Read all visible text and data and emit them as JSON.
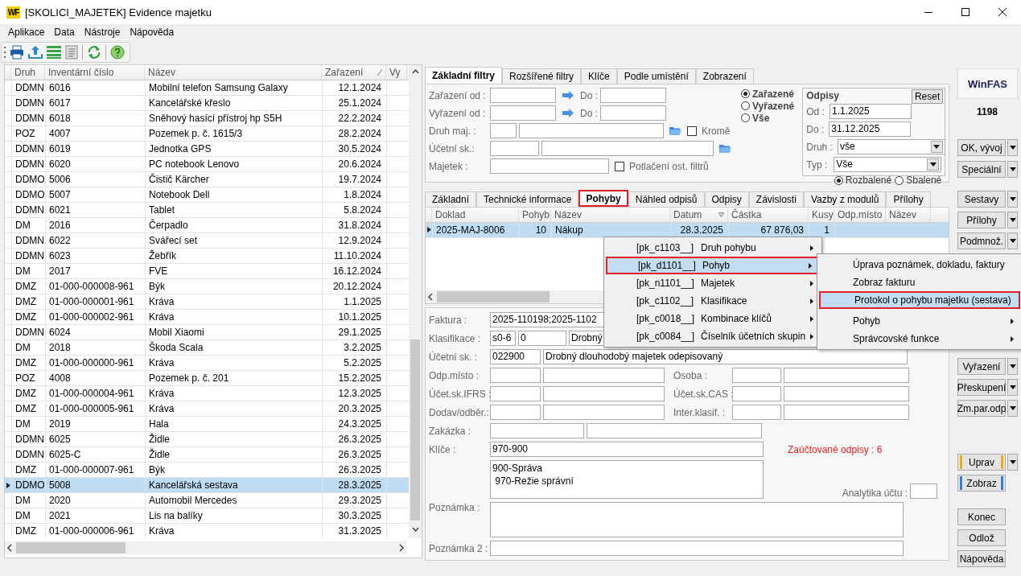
{
  "window": {
    "title": "[SKOLICI_MAJETEK] Evidence majetku",
    "app_badge": "WF"
  },
  "menu": [
    "Aplikace",
    "Data",
    "Nástroje",
    "Nápověda"
  ],
  "asset_table": {
    "columns": [
      "Druh",
      "Inventární číslo",
      "Název",
      "Zařazení",
      "Vy"
    ],
    "rows": [
      {
        "cells": [
          "DDMN",
          "6016",
          "Mobilní telefon Samsung Galaxy",
          "12.1.2024"
        ],
        "selected": false
      },
      {
        "cells": [
          "DDMN",
          "6017",
          "Kancelářské křeslo",
          "25.1.2024"
        ],
        "selected": false
      },
      {
        "cells": [
          "DDMN",
          "6018",
          "Sněhový hasící přístroj hp S5H",
          "22.2.2024"
        ],
        "selected": false
      },
      {
        "cells": [
          "POZ",
          "4007",
          "Pozemek p. č. 1615/3",
          "28.2.2024"
        ],
        "selected": false
      },
      {
        "cells": [
          "DDMN",
          "6019",
          "Jednotka GPS",
          "30.5.2024"
        ],
        "selected": false
      },
      {
        "cells": [
          "DDMN",
          "6020",
          "PC notebook Lenovo",
          "20.6.2024"
        ],
        "selected": false
      },
      {
        "cells": [
          "DDMO",
          "5006",
          "Čistič Kärcher",
          "19.7.2024"
        ],
        "selected": false
      },
      {
        "cells": [
          "DDMO",
          "5007",
          "Notebook Dell",
          "1.8.2024"
        ],
        "selected": false
      },
      {
        "cells": [
          "DDMN",
          "6021",
          "Tablet",
          "5.8.2024"
        ],
        "selected": false
      },
      {
        "cells": [
          "DM",
          "2016",
          "Čerpadlo",
          "31.8.2024"
        ],
        "selected": false
      },
      {
        "cells": [
          "DDMN",
          "6022",
          "Svářecí set",
          "12.9.2024"
        ],
        "selected": false
      },
      {
        "cells": [
          "DDMN",
          "6023",
          "Žebřík",
          "11.10.2024"
        ],
        "selected": false
      },
      {
        "cells": [
          "DM",
          "2017",
          "FVE",
          "16.12.2024"
        ],
        "selected": false
      },
      {
        "cells": [
          "DMZ",
          "01-000-000008-961",
          "Býk",
          "20.12.2024"
        ],
        "selected": false
      },
      {
        "cells": [
          "DMZ",
          "01-000-000001-961",
          "Kráva",
          "1.1.2025"
        ],
        "selected": false
      },
      {
        "cells": [
          "DMZ",
          "01-000-000002-961",
          "Kráva",
          "10.1.2025"
        ],
        "selected": false
      },
      {
        "cells": [
          "DDMN",
          "6024",
          "Mobil Xiaomi",
          "29.1.2025"
        ],
        "selected": false
      },
      {
        "cells": [
          "DM",
          "2018",
          "Škoda Scala",
          "3.2.2025"
        ],
        "selected": false
      },
      {
        "cells": [
          "DMZ",
          "01-000-000000-961",
          "Kráva",
          "5.2.2025"
        ],
        "selected": false
      },
      {
        "cells": [
          "POZ",
          "4008",
          "Pozemek p. č. 201",
          "15.2.2025"
        ],
        "selected": false
      },
      {
        "cells": [
          "DMZ",
          "01-000-000004-961",
          "Kráva",
          "12.3.2025"
        ],
        "selected": false
      },
      {
        "cells": [
          "DMZ",
          "01-000-000005-961",
          "Kráva",
          "20.3.2025"
        ],
        "selected": false
      },
      {
        "cells": [
          "DM",
          "2019",
          "Hala",
          "24.3.2025"
        ],
        "selected": false
      },
      {
        "cells": [
          "DDMN",
          "6025",
          "Židle",
          "26.3.2025"
        ],
        "selected": false
      },
      {
        "cells": [
          "DDMN",
          "6025-C",
          "Židle",
          "26.3.2025"
        ],
        "selected": false
      },
      {
        "cells": [
          "DMZ",
          "01-000-000007-961",
          "Býk",
          "26.3.2025"
        ],
        "selected": false
      },
      {
        "cells": [
          "DDMO",
          "5008",
          "Kancelářská sestava",
          "28.3.2025"
        ],
        "selected": true
      },
      {
        "cells": [
          "DM",
          "2020",
          "Automobil Mercedes",
          "29.3.2025"
        ],
        "selected": false
      },
      {
        "cells": [
          "DM",
          "2021",
          "Lis na balíky",
          "30.3.2025"
        ],
        "selected": false
      },
      {
        "cells": [
          "DMZ",
          "01-000-000006-961",
          "Kráva",
          "31.3.2025"
        ],
        "selected": false
      }
    ]
  },
  "filter_tabs": [
    {
      "label": "Základní filtry",
      "selected": true
    },
    {
      "label": "Rozšířené filtry",
      "selected": false
    },
    {
      "label": "Klíče",
      "selected": false
    },
    {
      "label": "Podle umístění",
      "selected": false
    },
    {
      "label": "Zobrazení",
      "selected": false
    }
  ],
  "filters": {
    "zarazeni": {
      "label": "Zařazení od :",
      "to_label": "Do :"
    },
    "vyrazeni": {
      "label": "Vyřazení od :",
      "to_label": "Do :"
    },
    "status_options": [
      {
        "label": "Zařazené",
        "selected": true
      },
      {
        "label": "Vyřazené",
        "selected": false
      },
      {
        "label": "Vše",
        "selected": false
      }
    ],
    "druh_maj": {
      "label": "Druh maj. :"
    },
    "krome": {
      "label": "Kromě",
      "checked": false
    },
    "ucetni_sk": {
      "label": "Účetní sk.:"
    },
    "majetek": {
      "label": "Majetek :"
    },
    "potlaceni": {
      "label": "Potlačení ost. filtrů",
      "checked": false
    }
  },
  "odpisy": {
    "title": "Odpisy",
    "reset": "Reset",
    "od_label": "Od :",
    "od": "1.1.2025",
    "do_label": "Do :",
    "do": "31.12.2025",
    "druh_label": "Druh :",
    "druh": "vše",
    "typ_label": "Typ :",
    "typ": "Vše",
    "view_options": [
      {
        "label": "Rozbalené",
        "selected": true
      },
      {
        "label": "Sbalené",
        "selected": false
      }
    ]
  },
  "detail_tabs": [
    {
      "label": "Základní",
      "selected": false,
      "highlighted": false
    },
    {
      "label": "Technické informace",
      "selected": false,
      "highlighted": false
    },
    {
      "label": "Pohyby",
      "selected": true,
      "highlighted": true
    },
    {
      "label": "Náhled odpisů",
      "selected": false,
      "highlighted": false
    },
    {
      "label": "Odpisy",
      "selected": false,
      "highlighted": false
    },
    {
      "label": "Závislosti",
      "selected": false,
      "highlighted": false
    },
    {
      "label": "Vazby z modulů",
      "selected": false,
      "highlighted": false
    },
    {
      "label": "Přílohy",
      "selected": false,
      "highlighted": false
    }
  ],
  "movements": {
    "columns": [
      "Doklad",
      "Pohyb",
      "Název",
      "Datum",
      "Částka",
      "Kusy",
      "Odp.místo",
      "Název"
    ],
    "rows": [
      {
        "cells": [
          "2025-MAJ-8006",
          "10",
          "Nákup",
          "28.3.2025",
          "67 876,03",
          "1"
        ],
        "selected": true
      }
    ]
  },
  "context_menu": {
    "items": [
      {
        "code": "[pk_c1103__]",
        "label": "Druh pohybu",
        "selected": false,
        "highlighted": false,
        "has_submenu": true
      },
      {
        "code": "[pk_d1101__]",
        "label": "Pohyb",
        "selected": true,
        "highlighted": true,
        "has_submenu": true
      },
      {
        "code": "[pk_n1101__]",
        "label": "Majetek",
        "selected": false,
        "highlighted": false,
        "has_submenu": true
      },
      {
        "code": "[pk_c1102__]",
        "label": "Klasifikace",
        "selected": false,
        "highlighted": false,
        "has_submenu": true
      },
      {
        "code": "[pk_c0018__]",
        "label": "Kombinace klíčů",
        "selected": false,
        "highlighted": false,
        "has_submenu": true
      },
      {
        "code": "[pk_c0084__]",
        "label": "Číselník účetních skupin",
        "selected": false,
        "highlighted": false,
        "has_submenu": true
      }
    ]
  },
  "submenu": {
    "items": [
      {
        "label": "Úprava poznámek, dokladu, faktury",
        "selected": false,
        "highlighted": false,
        "has_submenu": false
      },
      {
        "label": "Zobraz fakturu",
        "selected": false,
        "highlighted": false,
        "has_submenu": false
      },
      {
        "label": "Protokol o pohybu majetku (sestava)",
        "selected": true,
        "highlighted": true,
        "has_submenu": false
      },
      {
        "label": "Pohyb",
        "selected": false,
        "highlighted": false,
        "has_submenu": true
      },
      {
        "label": "Správcovské funkce",
        "selected": false,
        "highlighted": false,
        "has_submenu": true
      }
    ]
  },
  "form": {
    "faktura": {
      "label": "Faktura :",
      "value": "2025-110198;2025-1102"
    },
    "klasifikace": {
      "label": "Klasifikace :",
      "values": [
        "s0-6",
        "0",
        "Drobný"
      ]
    },
    "ucetni_sk": {
      "label": "Účetní sk. :",
      "values": [
        "022900",
        "Drobný dlouhodobý majetek odepisovaný"
      ]
    },
    "odp_misto": {
      "label": "Odp.místo :"
    },
    "osoba": {
      "label": "Osoba :"
    },
    "ucet_ifrs": {
      "label": "Účet.sk.IFRS :"
    },
    "ucet_cas": {
      "label": "Účet.sk.CAS :"
    },
    "dodav": {
      "label": "Dodav/odběr.:"
    },
    "inter": {
      "label": "Inter.klasif. :"
    },
    "zakazka": {
      "label": "Zakázka :"
    },
    "klice": {
      "label": "Klíče :",
      "value": "970-900",
      "lines": [
        "900-Správa",
        " 970-Režie správní"
      ]
    },
    "posted": "Zaúčtované odpisy : 6",
    "analytika": {
      "label": "Analytika účtu :"
    },
    "poznamka": {
      "label": "Poznámka :"
    },
    "poznamka2": {
      "label": "Poznámka 2 :"
    }
  },
  "side": {
    "logo": "WinFAS",
    "number": "1198",
    "button_groups": [
      [
        {
          "label": "OK, vývoj",
          "dropdown": true
        },
        {
          "label": "Speciální",
          "dropdown": true
        }
      ],
      [
        {
          "label": "Sestavy",
          "dropdown": true
        },
        {
          "label": "Přílohy",
          "dropdown": true
        },
        {
          "label": "Podmnož.",
          "dropdown": true
        }
      ],
      [
        {
          "label": "Vyřazení",
          "dropdown": true
        },
        {
          "label": "Přeskupení",
          "dropdown": true
        },
        {
          "label": "Zm.par.odp",
          "dropdown": true
        }
      ],
      [
        {
          "label": "Uprav",
          "dropdown": true,
          "color": "#e8b020"
        },
        {
          "label": "Zobraz",
          "dropdown": false,
          "color": "#3a7bd5"
        }
      ],
      [
        {
          "label": "Konec",
          "dropdown": false
        },
        {
          "label": "Odlož",
          "dropdown": false
        },
        {
          "label": "Nápověda",
          "dropdown": false
        }
      ]
    ]
  }
}
